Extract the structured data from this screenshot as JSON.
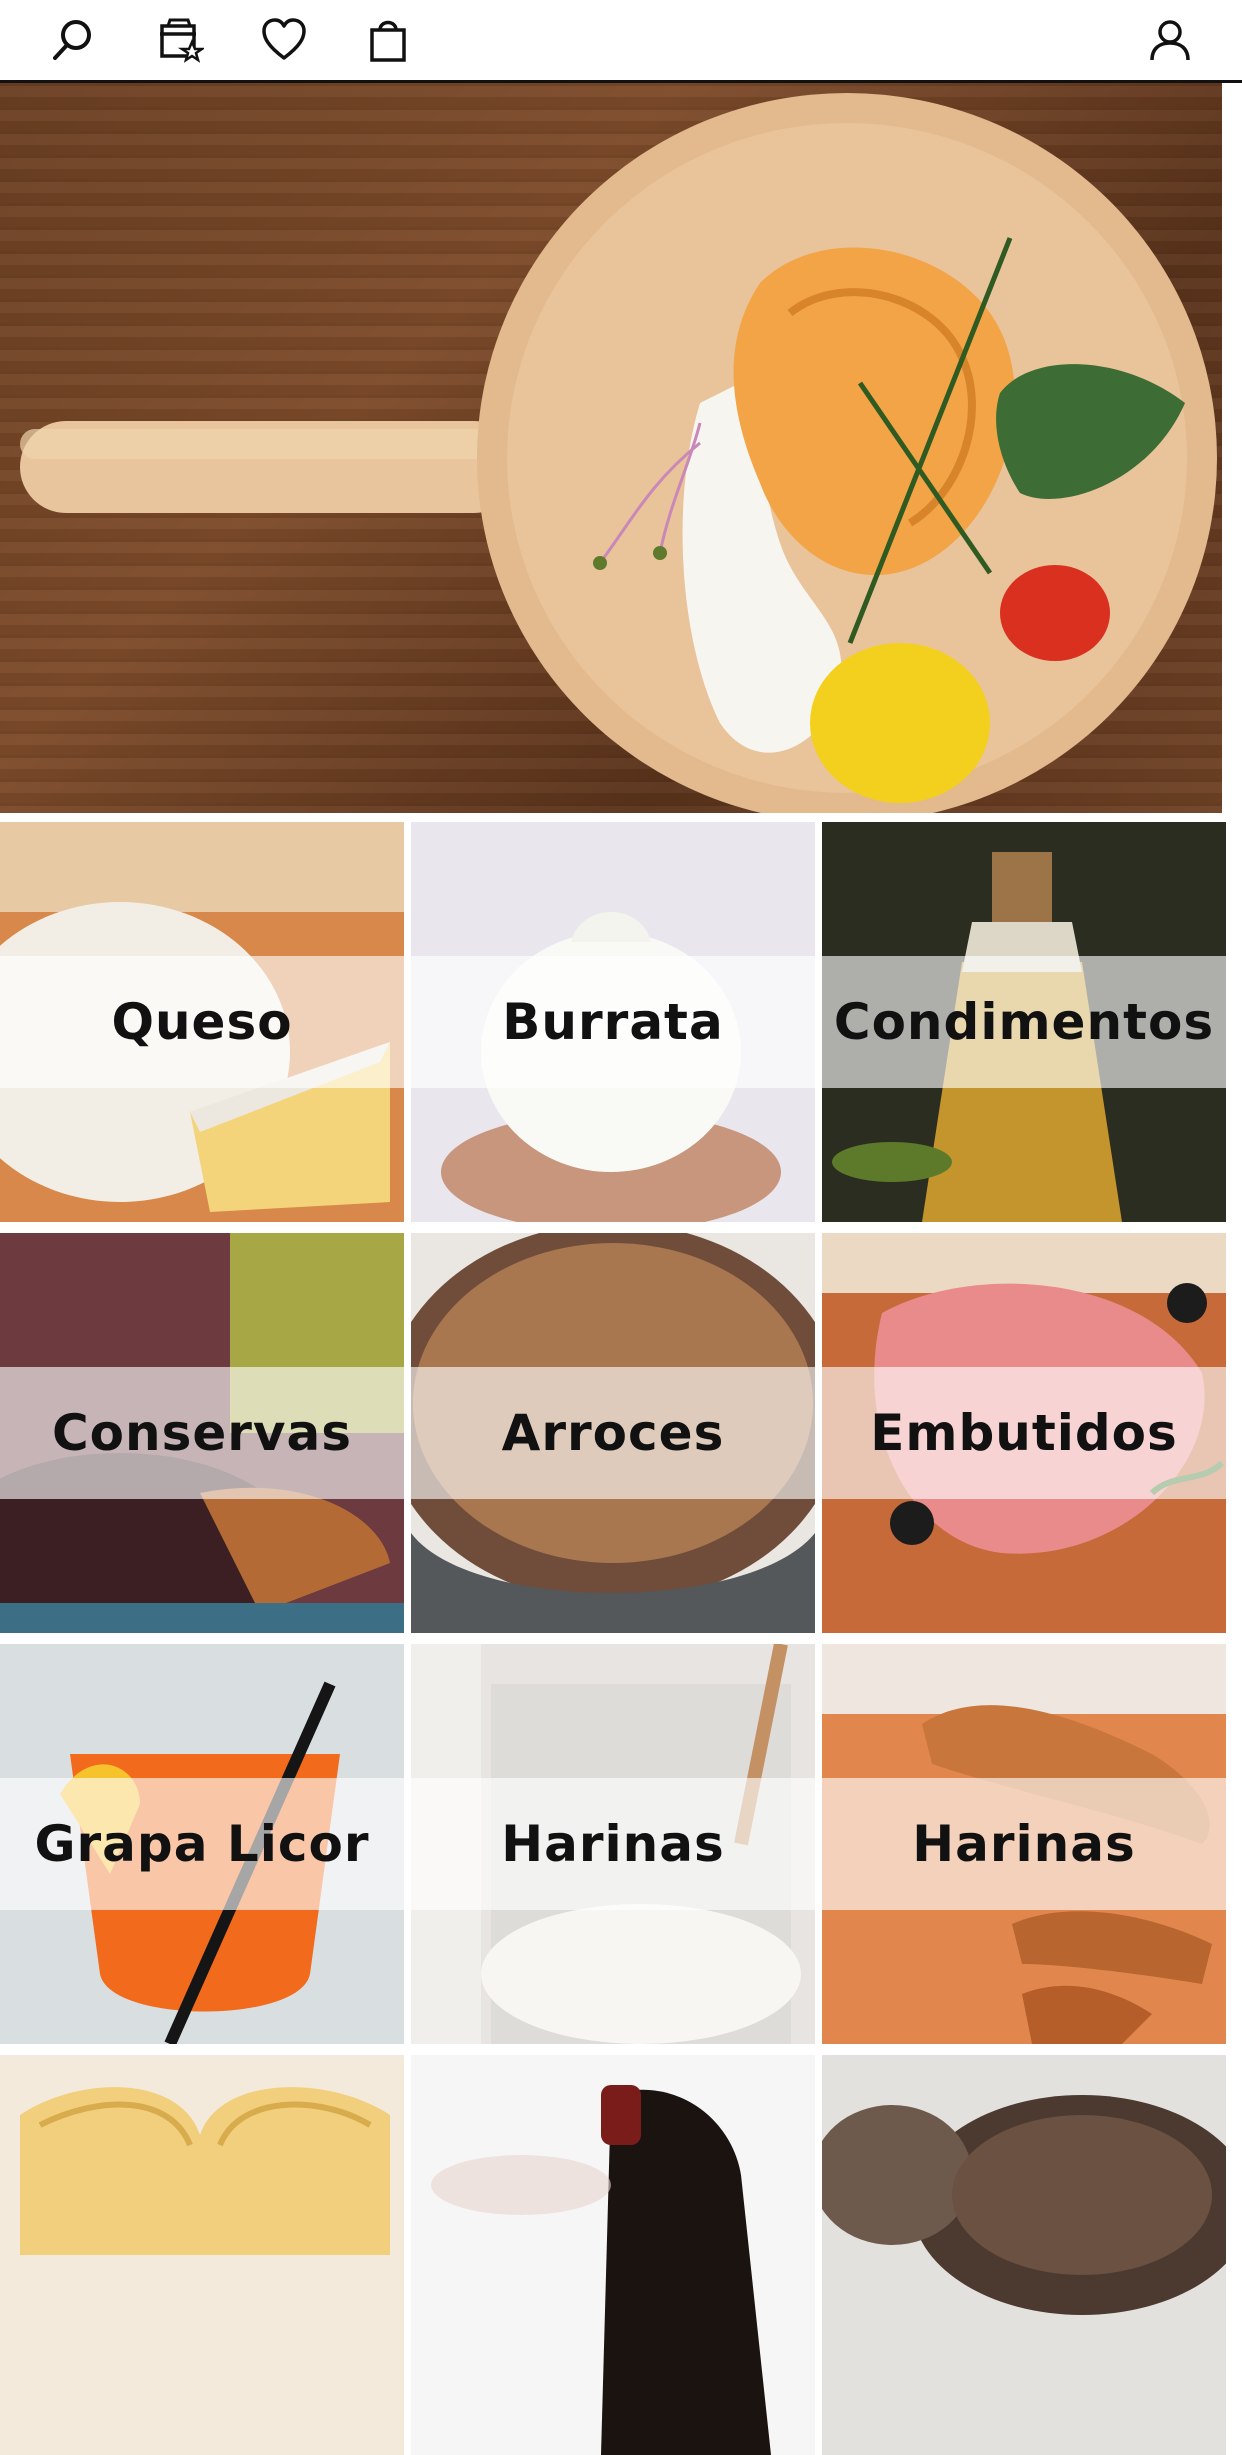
{
  "header": {
    "icons": [
      "search-icon",
      "store-favorites-icon",
      "heart-icon",
      "shopping-bag-icon",
      "user-icon"
    ]
  },
  "hero": {
    "image": "stuffed pasta on wooden paddle board"
  },
  "categories": [
    {
      "label": "Queso",
      "image": "cheese"
    },
    {
      "label": "Burrata",
      "image": "burrata"
    },
    {
      "label": "Condimentos",
      "image": "olive oil bottle"
    },
    {
      "label": "Conservas",
      "image": "olives"
    },
    {
      "label": "Arroces",
      "image": "rice"
    },
    {
      "label": "Embutidos",
      "image": "cured ham"
    },
    {
      "label": "Grapa Licor",
      "image": "spritz cocktail"
    },
    {
      "label": "Harinas",
      "image": "flour jar"
    },
    {
      "label": "Harinas",
      "image": "breadsticks"
    },
    {
      "label": "",
      "image": "pasta"
    },
    {
      "label": "",
      "image": "wine bottle"
    },
    {
      "label": "",
      "image": "truffle"
    }
  ],
  "colors": {
    "header_border": "#111111",
    "band_overlay": "#ffffff",
    "label_text": "#111111"
  }
}
